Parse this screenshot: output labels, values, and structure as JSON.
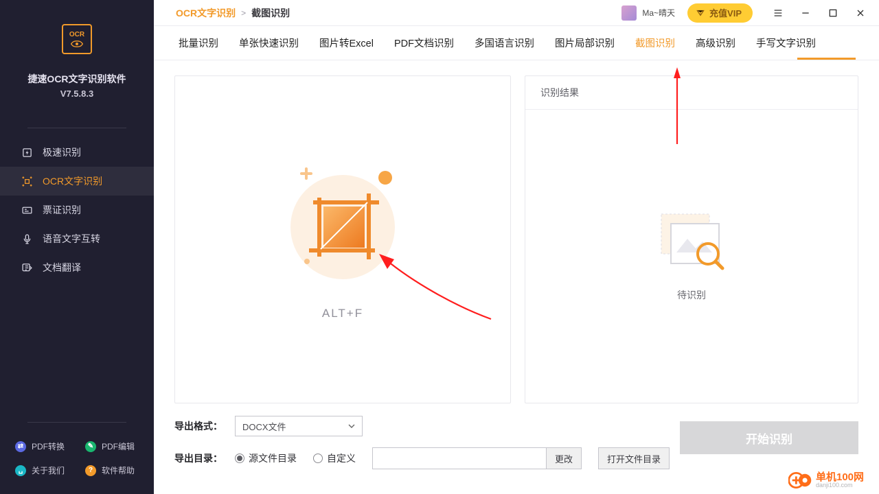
{
  "brand": {
    "name": "捷速OCR文字识别软件",
    "version": "V7.5.8.3",
    "logo_text": "OCR"
  },
  "sidebar": {
    "items": [
      {
        "label": "极速识别",
        "icon": "bolt-icon",
        "active": false
      },
      {
        "label": "OCR文字识别",
        "icon": "crop-icon",
        "active": true
      },
      {
        "label": "票证识别",
        "icon": "card-icon",
        "active": false
      },
      {
        "label": "语音文字互转",
        "icon": "microphone-icon",
        "active": false
      },
      {
        "label": "文档翻译",
        "icon": "translate-icon",
        "active": false
      }
    ],
    "footer": [
      {
        "label": "PDF转换",
        "color": "sf-blue"
      },
      {
        "label": "PDF编辑",
        "color": "sf-green"
      },
      {
        "label": "关于我们",
        "color": "sf-teal"
      },
      {
        "label": "软件帮助",
        "color": "sf-orange"
      }
    ]
  },
  "header": {
    "breadcrumb_root": "OCR文字识别",
    "breadcrumb_sep": ">",
    "breadcrumb_leaf": "截图识别",
    "user_name": "Ma~晴天",
    "vip_label": "充值VIP"
  },
  "tabs": [
    {
      "label": "批量识别"
    },
    {
      "label": "单张快速识别"
    },
    {
      "label": "图片转Excel"
    },
    {
      "label": "PDF文档识别"
    },
    {
      "label": "多国语言识别"
    },
    {
      "label": "图片局部识别"
    },
    {
      "label": "截图识别",
      "active": true
    },
    {
      "label": "高级识别"
    },
    {
      "label": "手写文字识别"
    }
  ],
  "left_panel": {
    "hotkey": "ALT+F"
  },
  "right_panel": {
    "title": "识别结果",
    "empty_text": "待识别"
  },
  "export": {
    "format_label": "导出格式：",
    "format_value": "DOCX文件",
    "dir_label": "导出目录：",
    "radio_source": "源文件目录",
    "radio_custom": "自定义",
    "change_btn": "更改",
    "open_btn": "打开文件目录",
    "start_btn": "开始识别"
  },
  "watermark": {
    "brand": "单机100网",
    "url": "danji100.com"
  },
  "colors": {
    "accent": "#f29a2a",
    "sidebar_bg": "#201f30",
    "vip": "#ffcc33"
  }
}
